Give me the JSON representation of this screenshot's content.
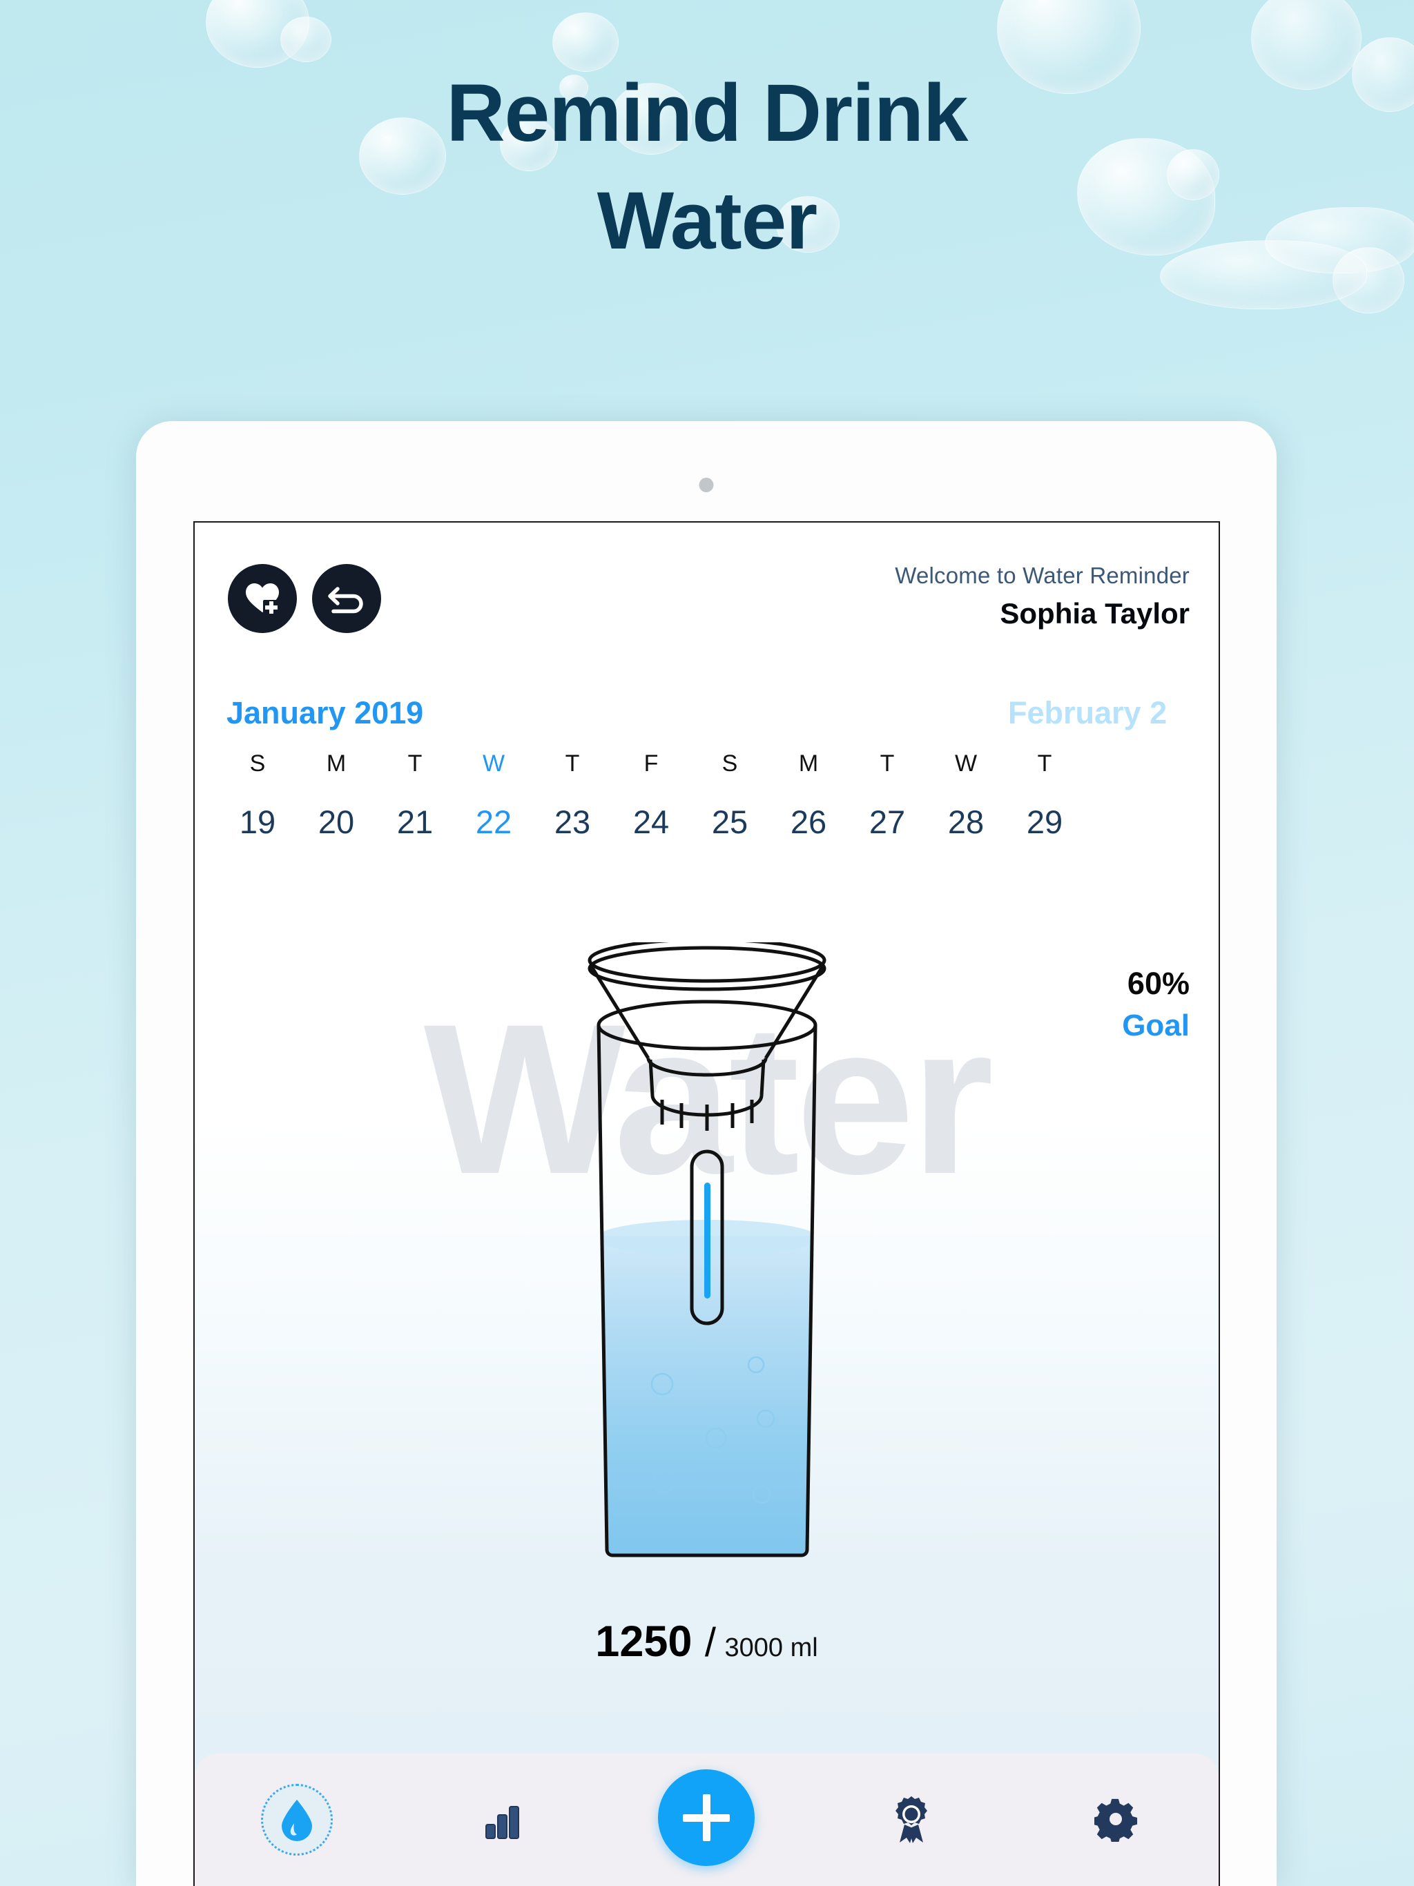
{
  "hero": {
    "line1": "Remind Drink",
    "line2": "Water"
  },
  "colors": {
    "page_background": "#c6ebf2",
    "hero_text": "#0b3a56",
    "accent_blue": "#2196f3",
    "accent_blue_light": "#b6e2fb",
    "fab_blue": "#10a3f7",
    "dark_icon": "#121b27",
    "nav_bar": "#f1eff3",
    "watermark": "#e2e6ea"
  },
  "app": {
    "header": {
      "favorite_icon": "heart-plus-icon",
      "back_icon": "undo-arrow-icon",
      "welcome_text": "Welcome to Water Reminder",
      "user_name": "Sophia Taylor"
    },
    "calendar": {
      "current_month": "January 2019",
      "next_month": "February 2",
      "selected_day": "22",
      "selected_dow": "W",
      "columns": [
        {
          "dow": "S",
          "day": "19"
        },
        {
          "dow": "M",
          "day": "20"
        },
        {
          "dow": "T",
          "day": "21"
        },
        {
          "dow": "W",
          "day": "22"
        },
        {
          "dow": "T",
          "day": "23"
        },
        {
          "dow": "F",
          "day": "24"
        },
        {
          "dow": "S",
          "day": "25"
        },
        {
          "dow": "M",
          "day": "26"
        },
        {
          "dow": "T",
          "day": "27"
        },
        {
          "dow": "W",
          "day": "28"
        },
        {
          "dow": "T",
          "day": "29"
        }
      ]
    },
    "watermark_text": "Water",
    "goal": {
      "percent": "60%",
      "label": "Goal"
    },
    "intake": {
      "current": "1250",
      "separator": "/",
      "target": "3000 ml"
    },
    "nav": [
      {
        "id": "water",
        "icon": "water-drop-icon",
        "active": true
      },
      {
        "id": "stats",
        "icon": "bar-chart-icon",
        "active": false
      },
      {
        "id": "add",
        "icon": "plus-icon",
        "active": false
      },
      {
        "id": "achievements",
        "icon": "award-ribbon-icon",
        "active": false
      },
      {
        "id": "settings",
        "icon": "gear-icon",
        "active": false
      }
    ]
  }
}
